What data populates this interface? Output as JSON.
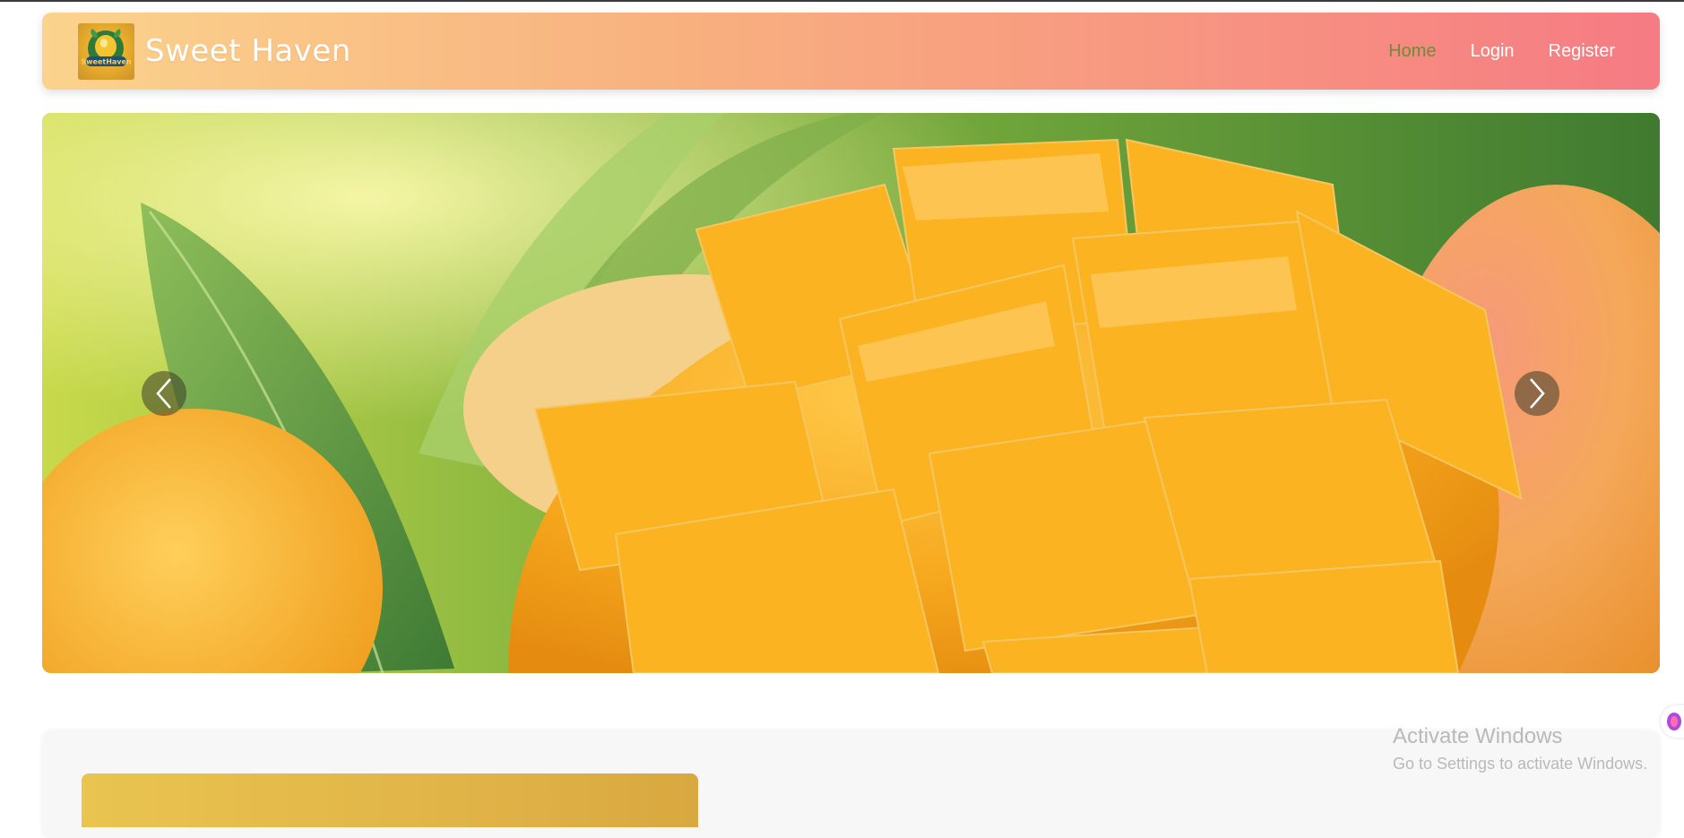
{
  "brand": {
    "name": "Sweet Haven",
    "logo_text": "SweetHaven"
  },
  "nav": {
    "items": [
      {
        "label": "Home",
        "active": true
      },
      {
        "label": "Login",
        "active": false
      },
      {
        "label": "Register",
        "active": false
      }
    ]
  },
  "carousel": {
    "slide_subject": "diced mango with leaves",
    "prev_icon": "chevron-left-icon",
    "next_icon": "chevron-right-icon"
  },
  "watermark": {
    "title": "Activate Windows",
    "subtitle": "Go to Settings to activate Windows."
  },
  "colors": {
    "navbar_start": "#fbd38d",
    "navbar_end": "#f67b83",
    "active_link": "#6b8e3a",
    "mango": "#f7a91e"
  }
}
